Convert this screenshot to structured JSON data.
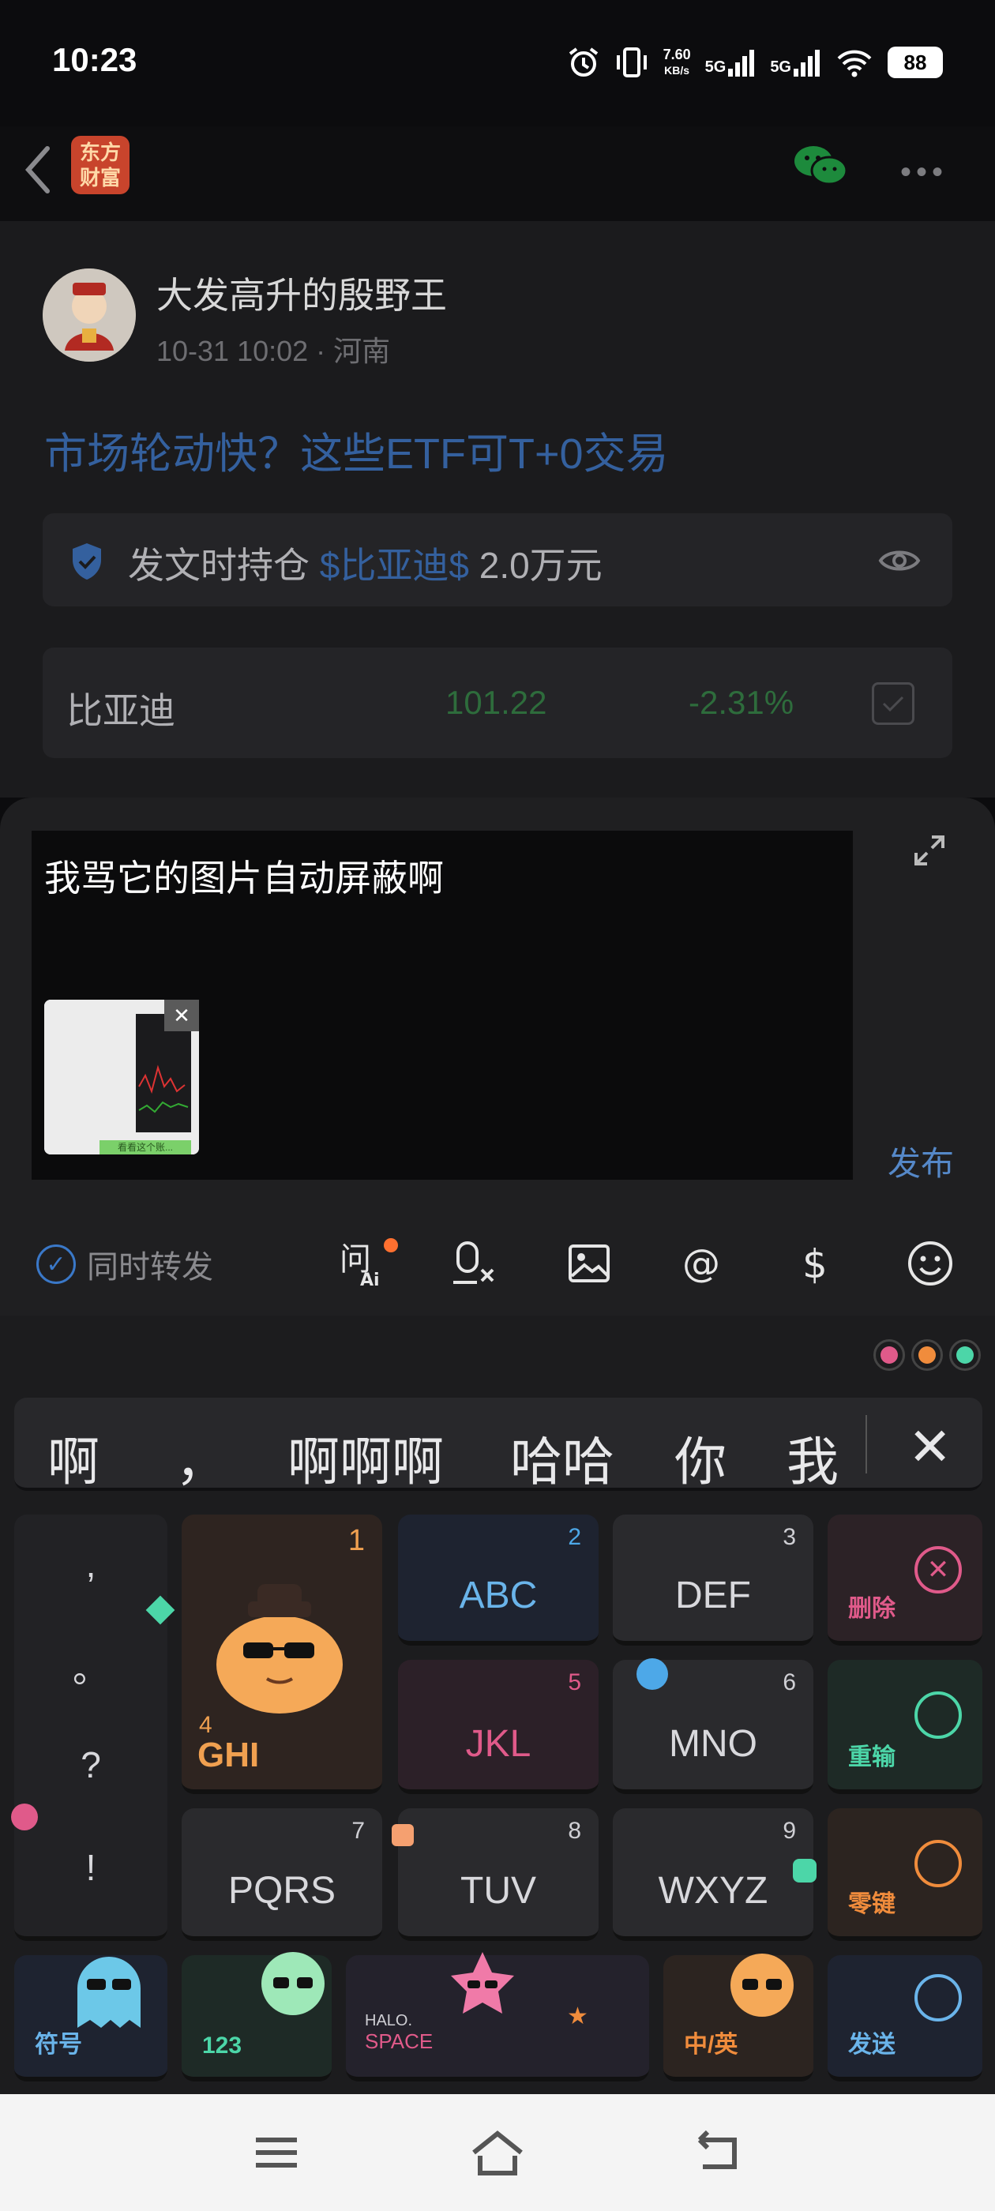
{
  "status_bar": {
    "time": "10:23",
    "net_speed_value": "7.60",
    "net_speed_unit": "KB/s",
    "sig1": "5G",
    "sig2": "5G",
    "battery": "88"
  },
  "nav": {
    "logo_line1": "东方",
    "logo_line2": "财富"
  },
  "post": {
    "username": "大发高升的殷野王",
    "meta": "10-31 10:02 · 河南",
    "title": "市场轮动快？这些ETF可T+0交易",
    "holding_prefix": "发文时持仓 ",
    "holding_stock": "$比亚迪$",
    "holding_amount": " 2.0万元",
    "stock_name": "比亚迪",
    "stock_price": "101.22",
    "stock_change": "-2.31%"
  },
  "composer": {
    "text": "我骂它的图片自动屏蔽啊",
    "thumb_caption": "看看这个账...",
    "publish_label": "发布",
    "forward_label": "同时转发",
    "tools": [
      "问Ai",
      "语音",
      "图片",
      "@",
      "$",
      "表情"
    ]
  },
  "keyboard": {
    "candidates": [
      "啊",
      "，",
      "啊啊啊",
      "哈哈",
      "你",
      "我"
    ],
    "close_glyph": "✕",
    "punct": [
      ",",
      "。",
      "?",
      "!"
    ],
    "keys": {
      "k1_num": "1",
      "k2_num": "2",
      "k2_lbl": "ABC",
      "k3_num": "3",
      "k3_lbl": "DEF",
      "k4_num": "4",
      "k4_lbl": "GHI",
      "k5_num": "5",
      "k5_lbl": "JKL",
      "k6_num": "6",
      "k6_lbl": "MNO",
      "k7_num": "7",
      "k7_lbl": "PQRS",
      "k8_num": "8",
      "k8_lbl": "TUV",
      "k9_num": "9",
      "k9_lbl": "WXYZ"
    },
    "delete_label": "删除",
    "reenter_label": "重输",
    "zero_label": "零键",
    "symbol_label": "符号",
    "num_label": "123",
    "space_line1": "HALO.",
    "space_line2": "SPACE",
    "lang_label": "中/英",
    "send_label": "发送"
  },
  "colors": {
    "accent_blue": "#34609e",
    "publish_blue": "#5588c8",
    "stock_green": "#2e6c3c",
    "notif_orange": "#ff7030"
  }
}
